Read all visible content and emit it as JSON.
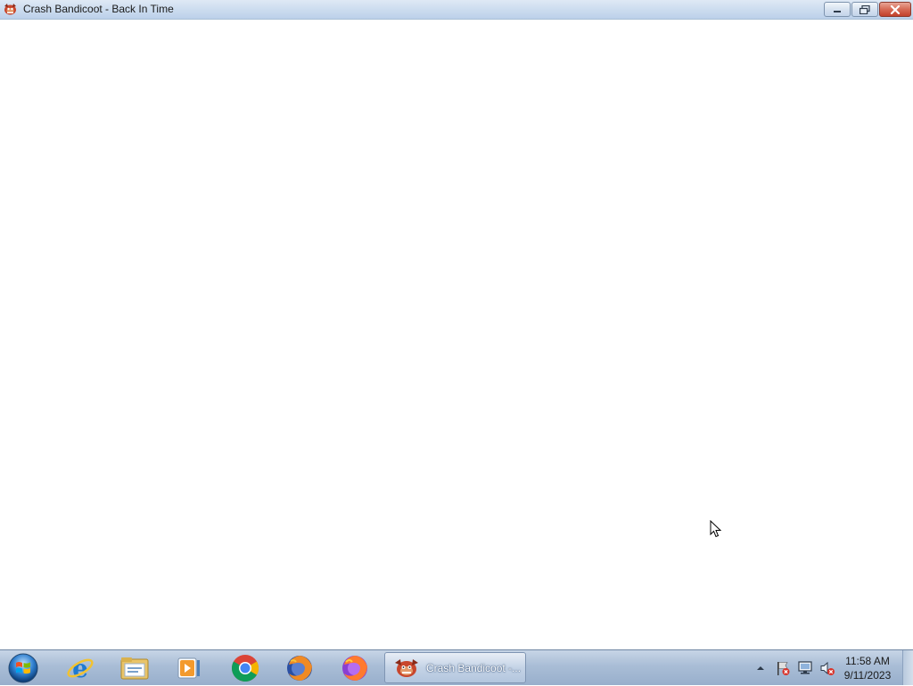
{
  "window": {
    "title": "Crash Bandicoot - Back In Time",
    "icon": "crash-bandicoot-icon",
    "buttons": {
      "minimize": "minimize-icon",
      "maximize": "restore-icon",
      "close": "close-icon"
    }
  },
  "taskbar": {
    "start": "windows-start-orb",
    "pinned": [
      {
        "name": "internet-explorer",
        "icon": "internet-explorer-icon"
      },
      {
        "name": "file-explorer",
        "icon": "folder-icon"
      },
      {
        "name": "media-player",
        "icon": "media-player-icon"
      },
      {
        "name": "chrome",
        "icon": "chrome-icon"
      },
      {
        "name": "firefox",
        "icon": "firefox-icon"
      },
      {
        "name": "firefox-2",
        "icon": "firefox-icon"
      }
    ],
    "active_task": {
      "label": "Crash Bandicoot -...",
      "icon": "crash-bandicoot-icon"
    },
    "tray": {
      "icons": [
        "show-hidden-icons",
        "action-center-flag-icon",
        "network-icon",
        "volume-muted-icon"
      ],
      "time": "11:58 AM",
      "date": "9/11/2023"
    }
  },
  "colors": {
    "titlebar": "#c9daee",
    "taskbar": "#a9bdd6",
    "close_button": "#c2412b"
  }
}
